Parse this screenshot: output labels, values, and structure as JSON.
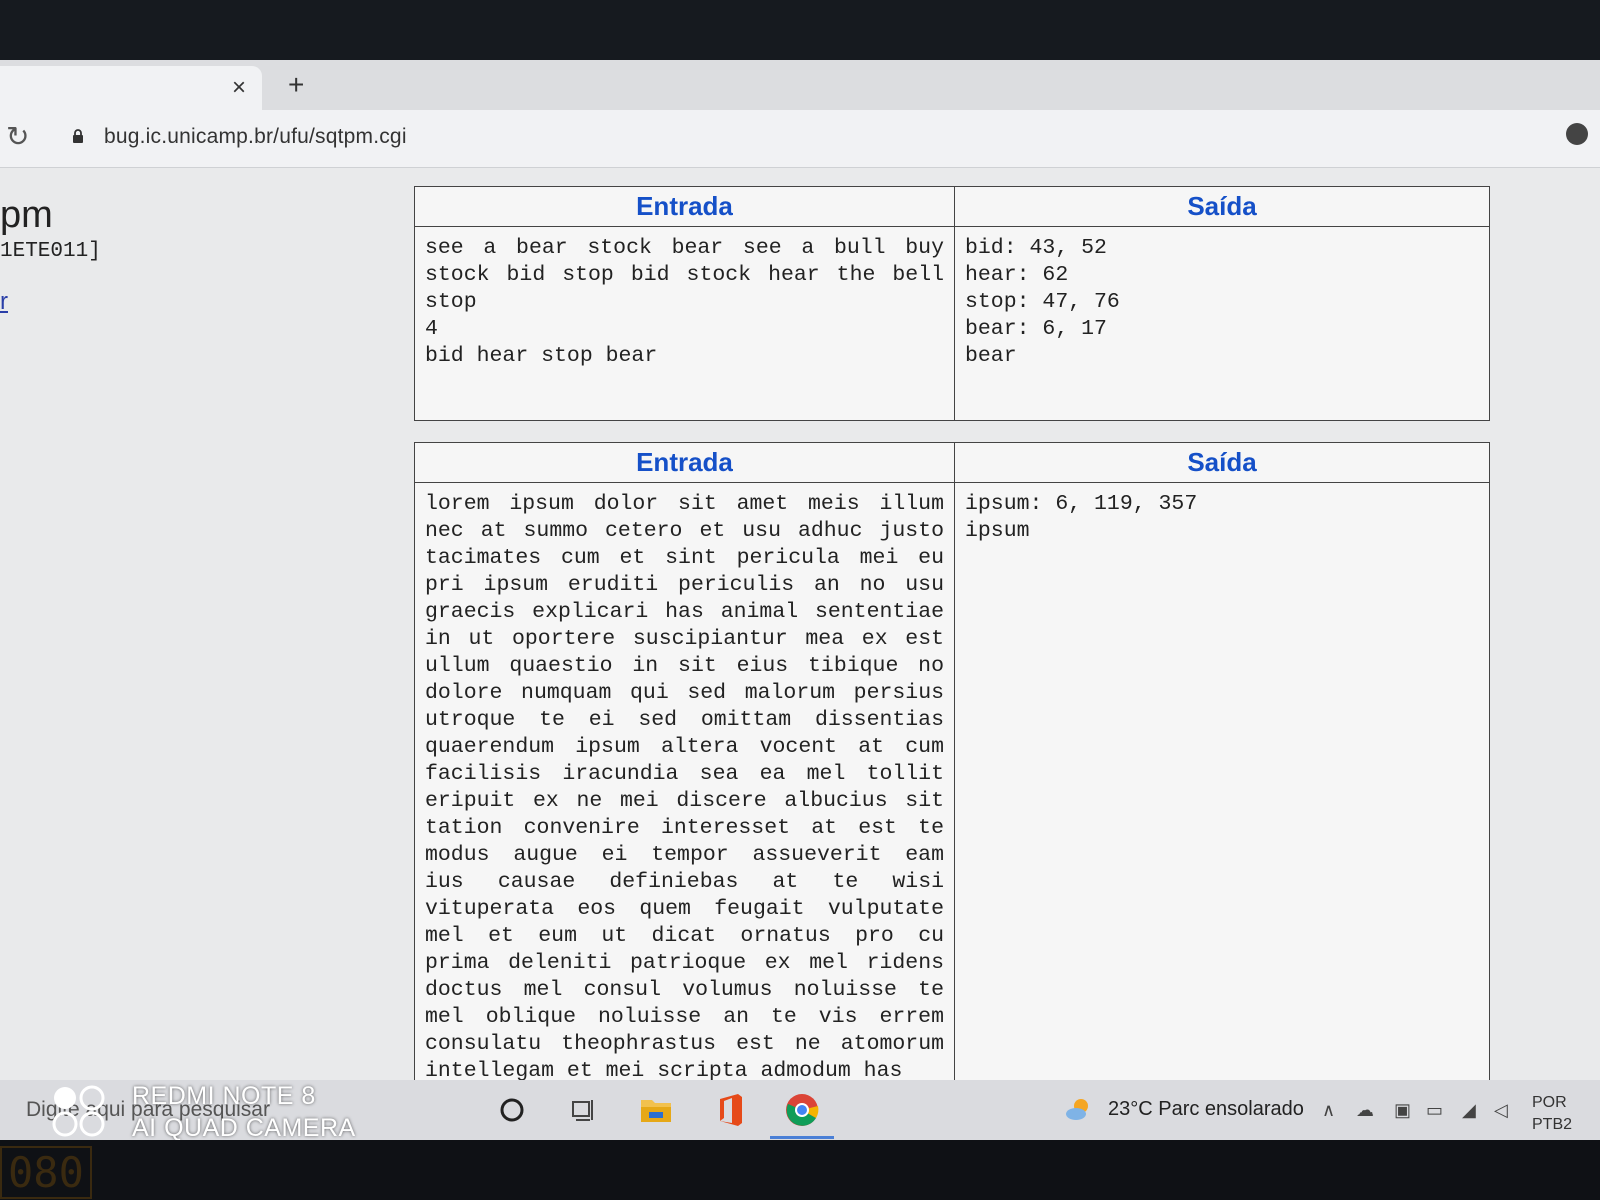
{
  "browser": {
    "new_tab_symbol": "+",
    "close_symbol": "×",
    "url": "bug.ic.unicamp.br/ufu/sqtpm.cgi"
  },
  "sidebar": {
    "title_fragment": "pm",
    "code_fragment": "1ETE011]",
    "link_fragment": "r"
  },
  "tables": [
    {
      "input_header": "Entrada",
      "output_header": "Saída",
      "input_lines": [
        "see a bear stock bear see a bull buy",
        "stock bid stop bid stock hear the bell",
        "stop",
        "4",
        "bid hear stop bear"
      ],
      "output_lines": [
        "bid: 43, 52",
        "hear: 62",
        "stop: 47, 76",
        "bear: 6, 17",
        "bear"
      ]
    },
    {
      "input_header": "Entrada",
      "output_header": "Saída",
      "input_lines": [
        "lorem ipsum dolor sit amet meis illum",
        "nec at summo cetero et usu adhuc justo",
        "tacimates cum et sint pericula mei eu",
        "pri ipsum eruditi periculis an no usu",
        "graecis explicari has animal sententiae",
        "in ut oportere suscipiantur mea ex est",
        "ullum quaestio in sit eius tibique no",
        "dolore numquam qui sed malorum persius",
        "utroque te ei sed omittam dissentias",
        "quaerendum ipsum altera vocent at cum",
        "facilisis iracundia sea ea mel tollit",
        "eripuit ex ne mei discere albucius sit",
        "tation convenire interesset at est te",
        "modus augue ei tempor assueverit eam",
        "ius causae definiebas at te wisi",
        "vituperata eos quem feugait vulputate",
        "mel et eum ut dicat ornatus pro cu",
        "prima deleniti patrioque ex mel ridens",
        "doctus mel consul volumus noluisse te",
        "mel oblique noluisse an te vis errem",
        "consulatu theophrastus est ne atomorum",
        "intellegam et mei scripta admodum has"
      ],
      "output_lines": [
        "ipsum: 6, 119, 357",
        "ipsum"
      ]
    }
  ],
  "taskbar": {
    "search_placeholder": "Digite aqui para pesquisar",
    "weather": "23°C Parc ensolarado",
    "lang_line1": "POR",
    "lang_line2": "PTB2"
  },
  "watermark": {
    "line1": "REDMI NOTE 8",
    "line2": "AI QUAD CAMERA"
  },
  "bezel": {
    "digits": "080"
  },
  "icons": {
    "cortana": "circle-icon",
    "task_view": "task-view-icon",
    "explorer": "folder-icon",
    "office": "office-icon",
    "chrome": "chrome-icon"
  }
}
